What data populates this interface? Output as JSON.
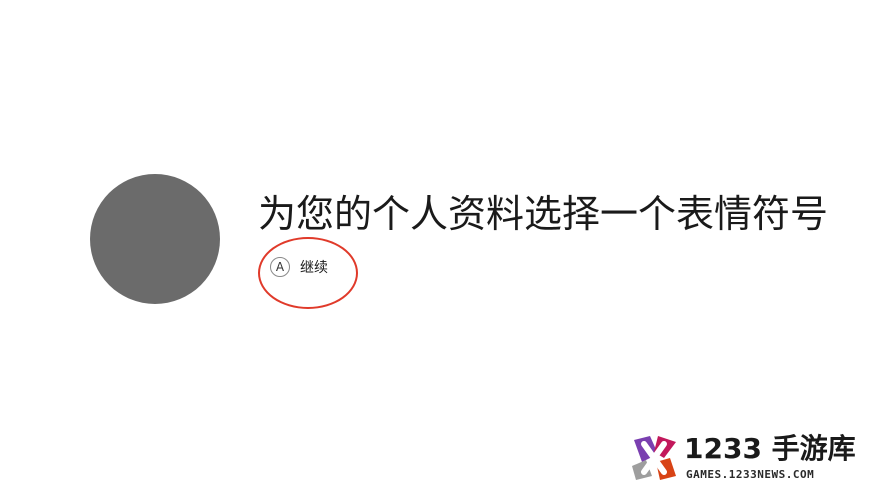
{
  "profile": {
    "title": "为您的个人资料选择一个表情符号",
    "avatar_color": "#6b6b6b"
  },
  "continue_button": {
    "glyph": "A",
    "label": "继续"
  },
  "annotation": {
    "ring_color": "#e03a2a"
  },
  "watermark": {
    "logo_icon": "x-logo-icon",
    "name": "1233 手游库",
    "url": "GAMES.1233NEWS.COM"
  }
}
